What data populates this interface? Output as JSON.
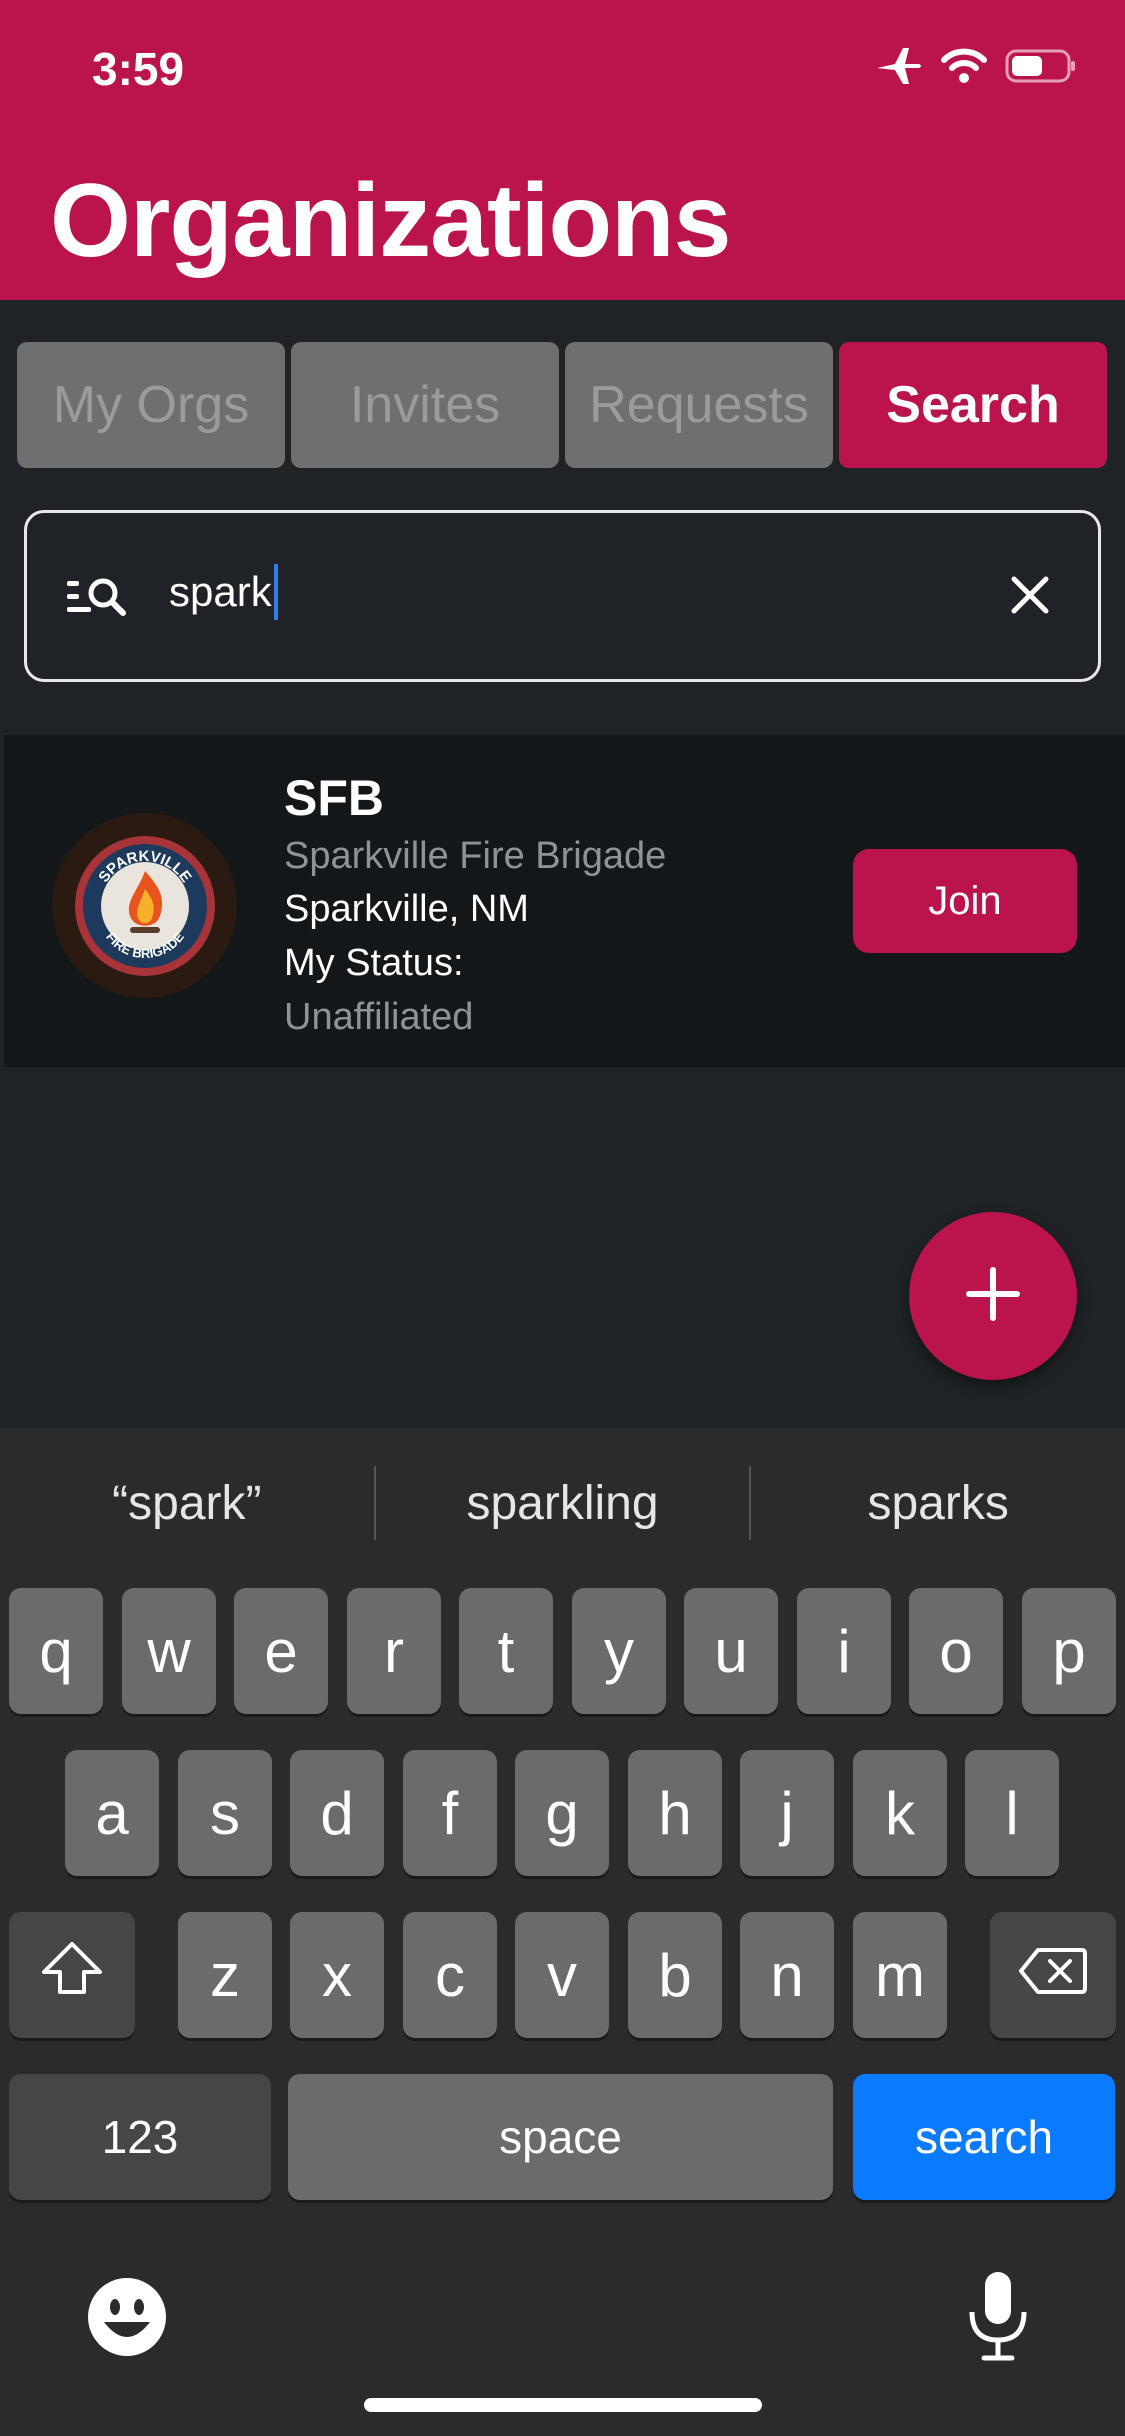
{
  "status_bar": {
    "time": "3:59"
  },
  "header": {
    "title": "Organizations"
  },
  "tabs": [
    {
      "label": "My Orgs",
      "active": false
    },
    {
      "label": "Invites",
      "active": false
    },
    {
      "label": "Requests",
      "active": false
    },
    {
      "label": "Search",
      "active": true
    }
  ],
  "search": {
    "value": "spark"
  },
  "results": [
    {
      "abbr": "SFB",
      "name": "Sparkville Fire Brigade",
      "location": "Sparkville, NM",
      "status_label": "My Status:",
      "status_value": "Unaffiliated",
      "action_label": "Join",
      "logo_text": [
        "SPARKVILLE",
        "FIRE BRIGADE"
      ]
    }
  ],
  "keyboard": {
    "suggestions": [
      "“spark”",
      "sparkling",
      "sparks"
    ],
    "row1": [
      "q",
      "w",
      "e",
      "r",
      "t",
      "y",
      "u",
      "i",
      "o",
      "p"
    ],
    "row2": [
      "a",
      "s",
      "d",
      "f",
      "g",
      "h",
      "j",
      "k",
      "l"
    ],
    "row3": [
      "z",
      "x",
      "c",
      "v",
      "b",
      "n",
      "m"
    ],
    "numbers_label": "123",
    "space_label": "space",
    "search_label": "search"
  },
  "colors": {
    "brand": "#bb134c",
    "key_blue": "#0a7bff"
  },
  "icons": [
    "airplane-icon",
    "wifi-icon",
    "battery-icon",
    "filter-search-icon",
    "close-icon",
    "plus-icon",
    "shift-icon",
    "backspace-icon",
    "emoji-icon",
    "microphone-icon"
  ]
}
